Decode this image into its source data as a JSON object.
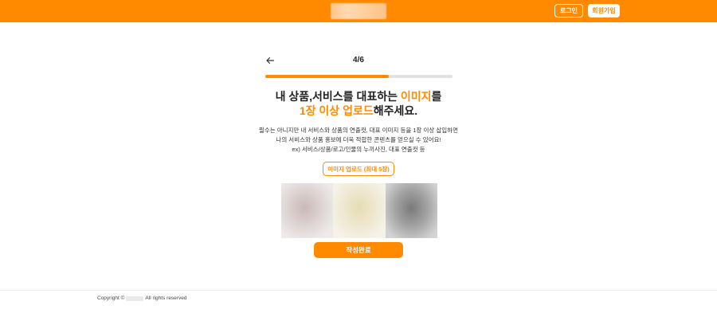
{
  "header": {
    "logo_alt": "brand-logo-blurred",
    "login_label": "로그인",
    "signup_label": "회원가입",
    "bar_color": "#ff8a00"
  },
  "nav": {
    "step": "4/6",
    "progress_fraction": 0.66
  },
  "main": {
    "headline_part1": "내 상품,서비스를 대표하는 ",
    "headline_accent1": "이미지",
    "headline_part2": "를",
    "headline_accent2": "1장 이상 업로드",
    "headline_part3": "해주세요.",
    "desc_line1": "필수는 아니지만 내 서비스와 상품의 연출컷, 대표 이미지 등을 1장 이상 삽입하면",
    "desc_line2": "나의 서비스와 상품 홍보에 더욱 적합한 콘텐츠를 얻으실 수 있어요!",
    "desc_line3": "ex) 서비스/상품/로고/인물의 누끼사진, 대표 연출컷 등",
    "upload_button_label": "이미지 업로드 (최대 5장)",
    "complete_button_label": "작성완료",
    "accent_color": "#ff8a00"
  },
  "footer": {
    "copyright_prefix": "Copyright ©",
    "copyright_suffix": "All rights reserved"
  }
}
